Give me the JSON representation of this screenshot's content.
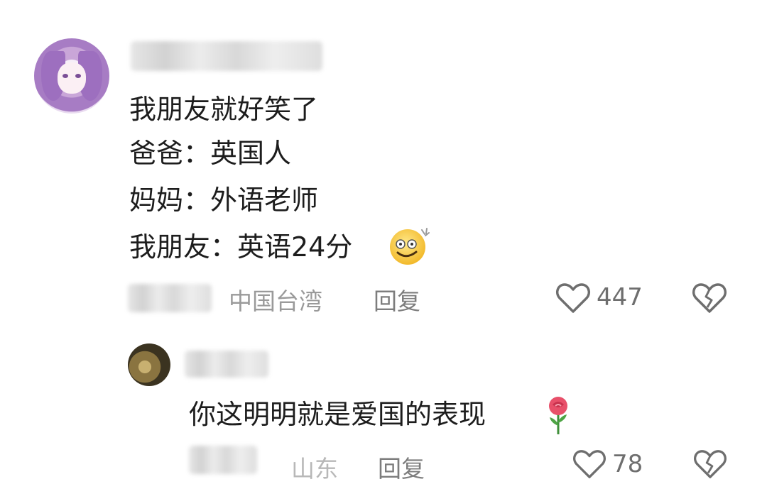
{
  "comment": {
    "lines": [
      "我朋友就好笑了",
      "爸爸：英国人",
      "妈妈：外语老师",
      "我朋友：英语24分"
    ],
    "emoji": "dizzy-smile-emoji",
    "location": "中国台湾",
    "reply_label": "回复",
    "like_count": "447",
    "icons": {
      "like": "heart-icon",
      "dislike": "broken-heart-icon"
    }
  },
  "reply": {
    "text": "你这明明就是爱国的表现",
    "emoji": "rose-icon",
    "location": "山东",
    "reply_label": "回复",
    "like_count": "78"
  },
  "colors": {
    "text": "#1d1d1d",
    "meta": "#9a9a9a",
    "icon": "#6e6e6e"
  }
}
